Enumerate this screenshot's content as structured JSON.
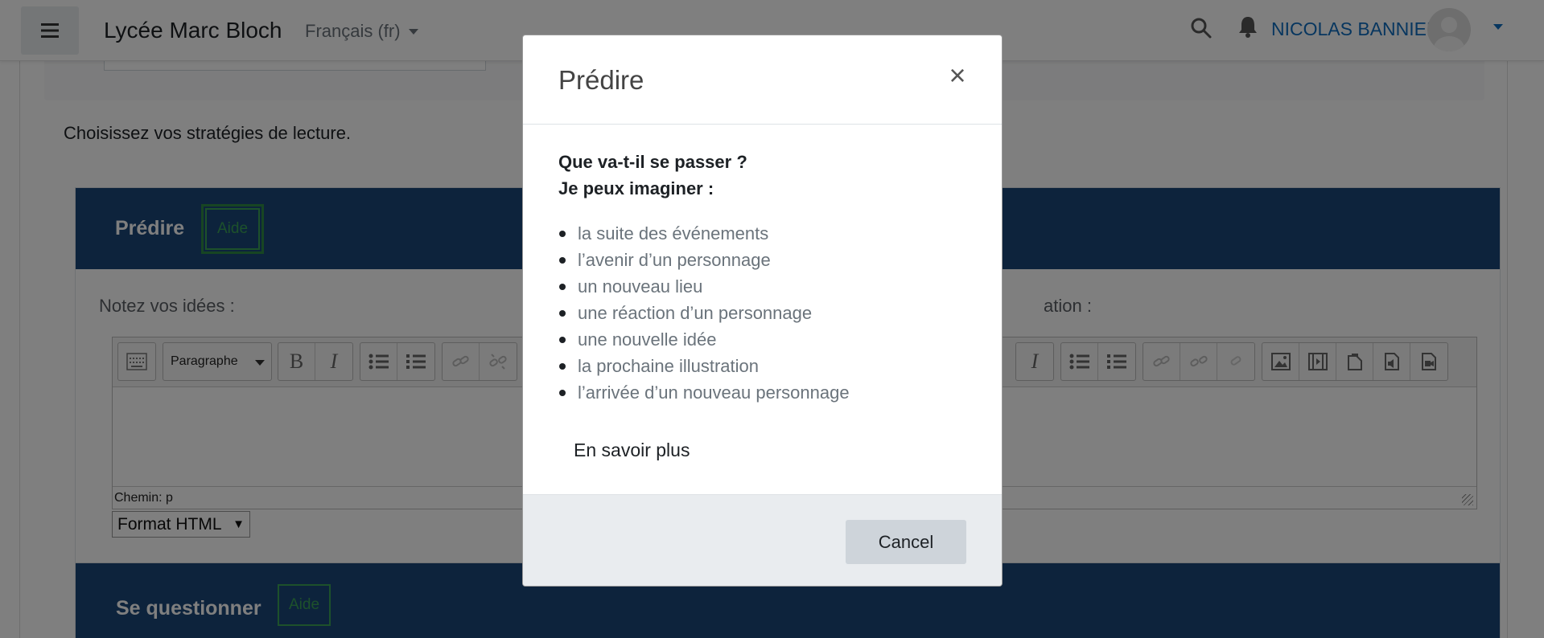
{
  "navbar": {
    "site_name": "Lycée Marc Bloch",
    "language": "Français (fr)",
    "user_name": "NICOLAS BANNIER",
    "menu_icon": "hamburger-icon",
    "search_icon": "search-icon",
    "notification_icon": "bell-icon"
  },
  "page": {
    "intro": "Choisissez vos stratégies de lecture."
  },
  "sections": [
    {
      "title": "Prédire",
      "help_label": "Aide",
      "note_label": "Notez vos idées :",
      "note_label_right": "ation :",
      "editor": {
        "paragraph_select": "Paragraphe",
        "bold": "B",
        "italic": "I",
        "path": "Chemin: p",
        "format": "Format HTML"
      }
    },
    {
      "title": "Se questionner",
      "help_label": "Aide"
    }
  ],
  "modal": {
    "title": "Prédire",
    "close_label": "×",
    "question": "Que va-t-il se passer ?",
    "prompt": "Je peux imaginer :",
    "ideas": [
      "la suite des événements",
      "l’avenir d’un personnage",
      "un nouveau lieu",
      "une réaction d’un personnage",
      "une nouvelle idée",
      "la prochaine illustration",
      "l’arrivée d’un nouveau personnage"
    ],
    "more_link": "En savoir plus",
    "cancel_label": "Cancel"
  },
  "colors": {
    "brand_blue": "#0f6cbf",
    "section_header": "#1b4779",
    "help_green": "#3aa357",
    "backdrop": "rgba(0,0,0,0.5)"
  }
}
